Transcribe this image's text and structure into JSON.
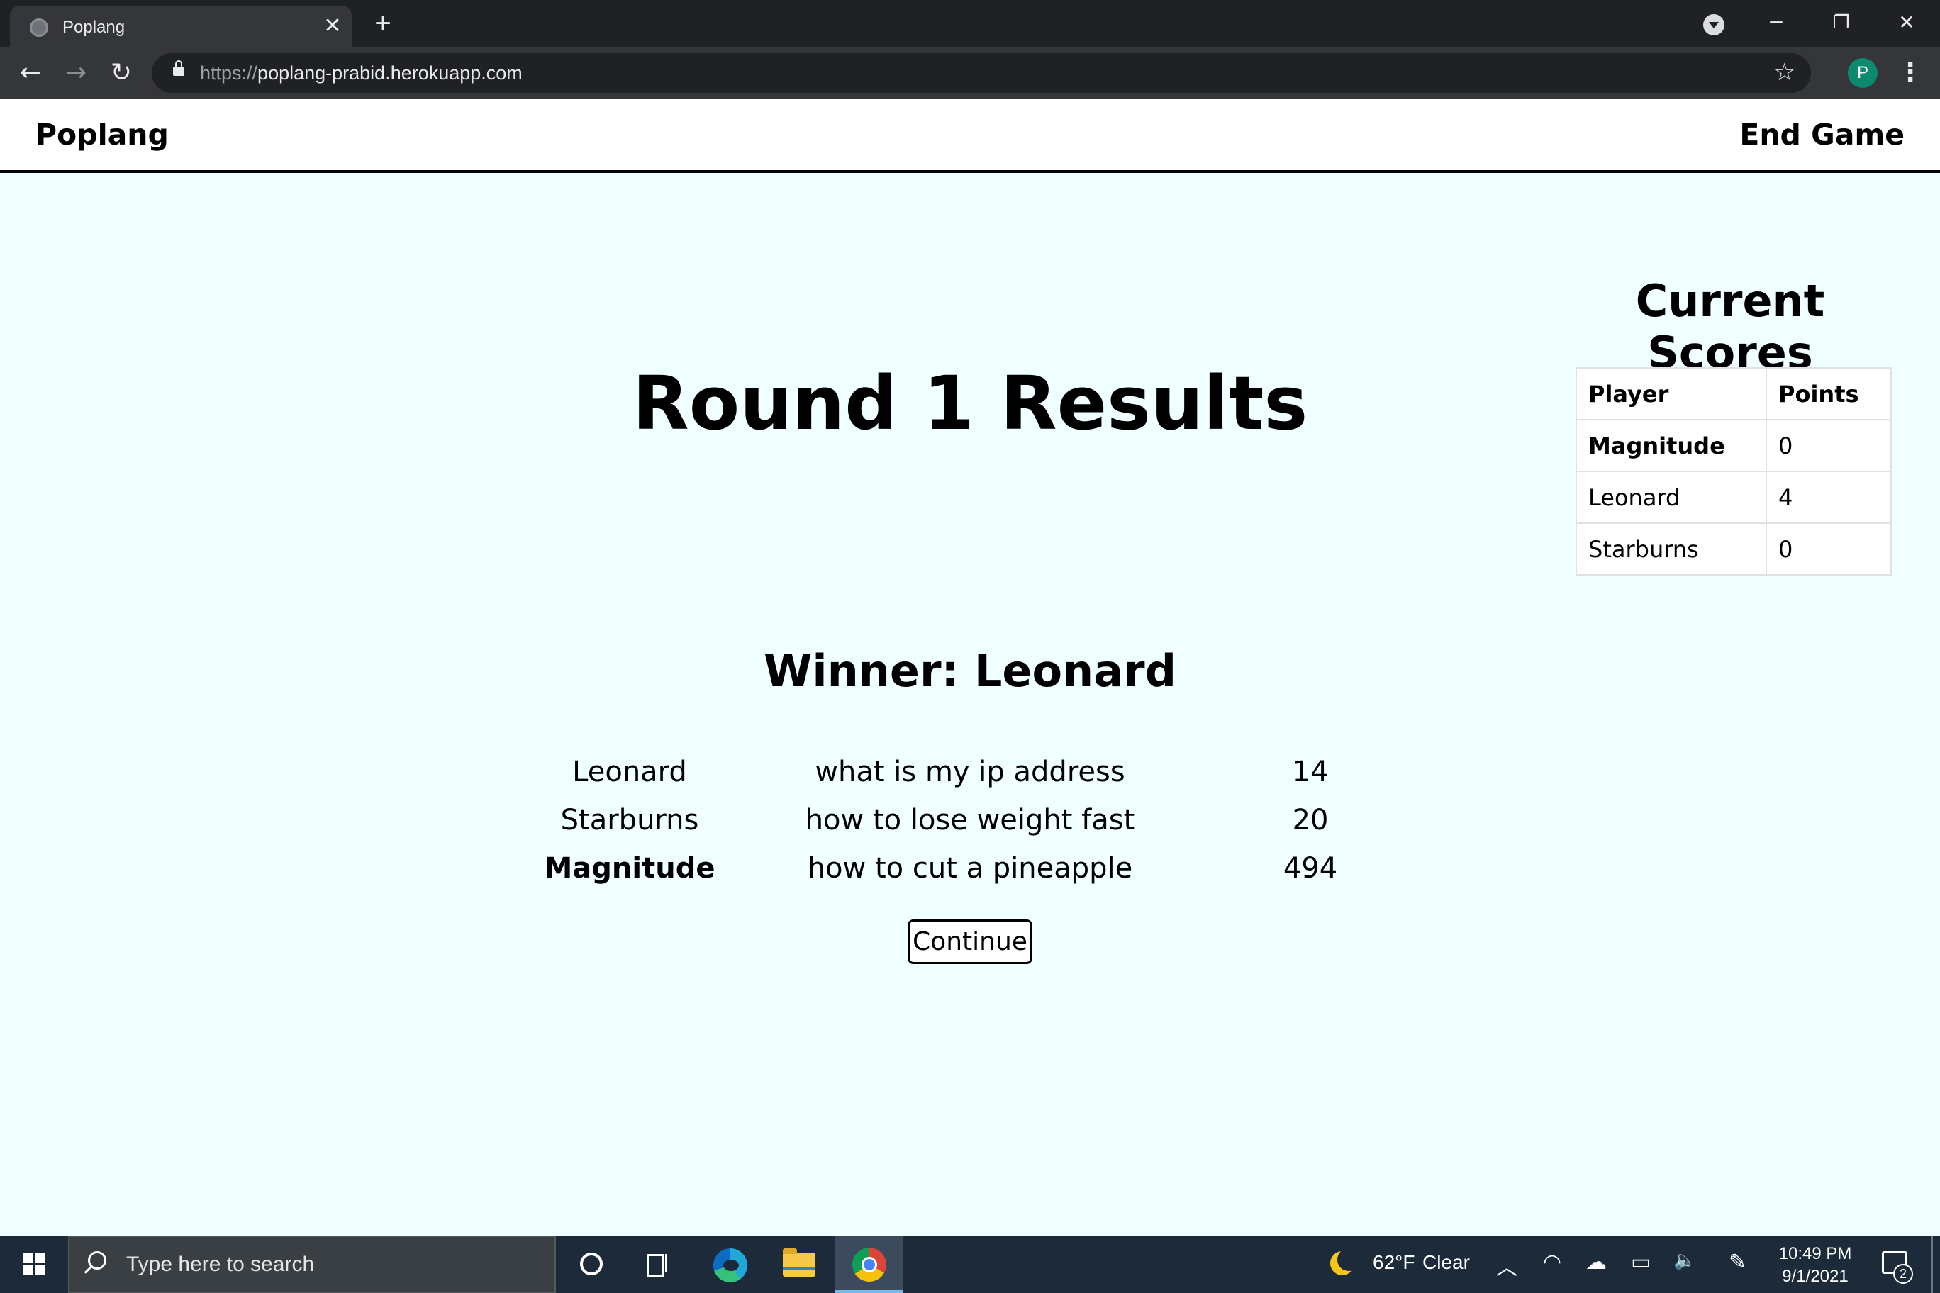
{
  "browser": {
    "tab_title": "Poplang",
    "tab_close": "✕",
    "new_tab": "+",
    "url_scheme": "https://",
    "url_host": "poplang-prabid.herokuapp.com",
    "profile_initial": "P",
    "window_controls": {
      "minimize": "─",
      "restore": "❐",
      "close": "✕"
    },
    "nav": {
      "back": "←",
      "forward": "→",
      "reload": "↻"
    },
    "star": "☆",
    "menu": "⋮",
    "accent_color": "#0b8a6f"
  },
  "navbar": {
    "brand": "Poplang",
    "end_game": "End Game"
  },
  "round": {
    "title": "Round 1 Results",
    "winner": "Winner: Leonard",
    "results": [
      {
        "player": "Leonard",
        "query": "what is my ip address",
        "count": "14",
        "bold": false
      },
      {
        "player": "Starburns",
        "query": "how to lose weight fast",
        "count": "20",
        "bold": false
      },
      {
        "player": "Magnitude",
        "query": "how to cut a pineapple",
        "count": "494",
        "bold": true
      }
    ],
    "continue_label": "Continue"
  },
  "scores": {
    "title": "Current Scores",
    "headers": [
      "Player",
      "Points"
    ],
    "rows": [
      {
        "player": "Magnitude",
        "points": "0",
        "bold": true
      },
      {
        "player": "Leonard",
        "points": "4",
        "bold": false
      },
      {
        "player": "Starburns",
        "points": "0",
        "bold": false
      }
    ]
  },
  "taskbar": {
    "search_placeholder": "Type here to search",
    "weather_temp": "62°F",
    "weather_desc": "Clear",
    "time": "10:49 PM",
    "date": "9/1/2021",
    "notification_count": "2",
    "icons": [
      "start-icon",
      "cortana-icon",
      "task-view-icon",
      "edge-icon",
      "file-explorer-icon",
      "chrome-icon",
      "moon-icon",
      "chevron-up-icon",
      "wifi-icon",
      "onedrive-icon",
      "battery-icon",
      "volume-icon",
      "pen-icon",
      "notification-icon"
    ],
    "tray_glyphs": {
      "chevron": "︿",
      "wifi": "◠",
      "cloud": "☁",
      "battery": "▭",
      "volume": "🔈",
      "pen": "✎"
    }
  }
}
